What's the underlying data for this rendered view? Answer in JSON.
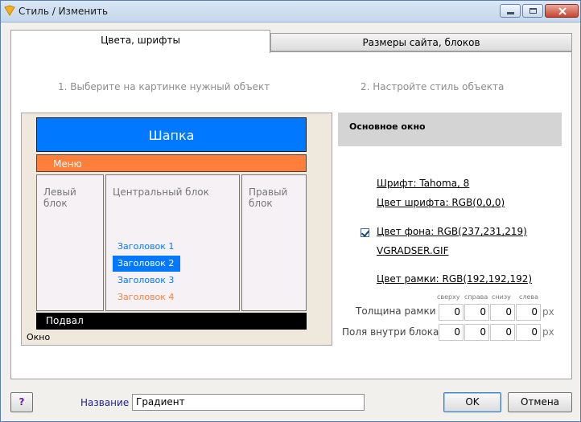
{
  "window": {
    "title": "Стиль / Изменить"
  },
  "tabs": [
    {
      "label": "Цвета, шрифты"
    },
    {
      "label": "Размеры сайта, блоков"
    }
  ],
  "steps": {
    "step1": "1. Выберите на картинке нужный объект",
    "step2": "2. Настройте стиль объекта"
  },
  "preview": {
    "header": "Шапка",
    "menu": "Меню",
    "left_block": "Левый блок",
    "center_block": "Центральный блок",
    "right_block": "Правый блок",
    "headings": [
      "Заголовок 1",
      "Заголовок 2",
      "Заголовок 3",
      "Заголовок 4"
    ],
    "footer": "Подвал",
    "window_label": "Окно",
    "colors": {
      "header": "#0078ff",
      "menu": "#ff7f3a",
      "footer": "#000000",
      "heading_link": "#0078ff",
      "heading_selected_bg": "#0078ff",
      "heading_alt": "#ff7f3a"
    }
  },
  "style": {
    "object_name": "Основное окно",
    "font": "Шрифт: Tahoma, 8",
    "font_color": "Цвет шрифта: RGB(0,0,0)",
    "bg_color_checked": true,
    "bg_color": "Цвет фона: RGB(237,231,219)",
    "bg_image": "VGRADSER.GIF",
    "border_color": "Цвет рамки: RGB(192,192,192)",
    "side_headers": [
      "сверху",
      "справа",
      "снизу",
      "слева"
    ],
    "border_width_label": "Толщина рамки",
    "border_width": [
      "0",
      "0",
      "0",
      "0"
    ],
    "padding_label": "Поля внутри блока",
    "padding": [
      "0",
      "0",
      "0",
      "0"
    ],
    "unit": "px"
  },
  "footer": {
    "help": "?",
    "name_label": "Название",
    "name_value": "Градиент",
    "ok": "OK",
    "cancel": "Отмена"
  }
}
